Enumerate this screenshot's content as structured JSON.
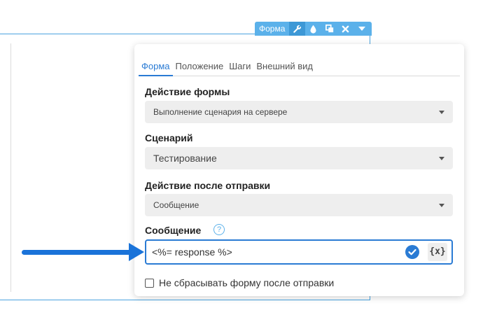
{
  "toolbar": {
    "label": "Форма",
    "buttons": [
      {
        "icon": "wrench-icon"
      },
      {
        "icon": "drop-icon"
      },
      {
        "icon": "copy-icon"
      },
      {
        "icon": "close-icon"
      },
      {
        "icon": "caret-down-icon"
      }
    ]
  },
  "tabs": [
    {
      "label": "Форма",
      "active": true
    },
    {
      "label": "Положение",
      "active": false
    },
    {
      "label": "Шаги",
      "active": false
    },
    {
      "label": "Внешний вид",
      "active": false
    }
  ],
  "form_action": {
    "label": "Действие формы",
    "value": "Выполнение сценария на сервере"
  },
  "scenario": {
    "label": "Сценарий",
    "value": "Тестирование"
  },
  "after_submit": {
    "label": "Действие после отправки",
    "value": "Сообщение"
  },
  "message": {
    "label": "Сообщение",
    "help": "?",
    "value": "<%= response %>",
    "var_button": "{x}"
  },
  "no_reset": {
    "label": "Не сбрасывать форму после отправки",
    "checked": false
  },
  "colors": {
    "accent": "#2a7bd4",
    "toolbar": "#5bb1ea",
    "arrow": "#1a73d9"
  }
}
